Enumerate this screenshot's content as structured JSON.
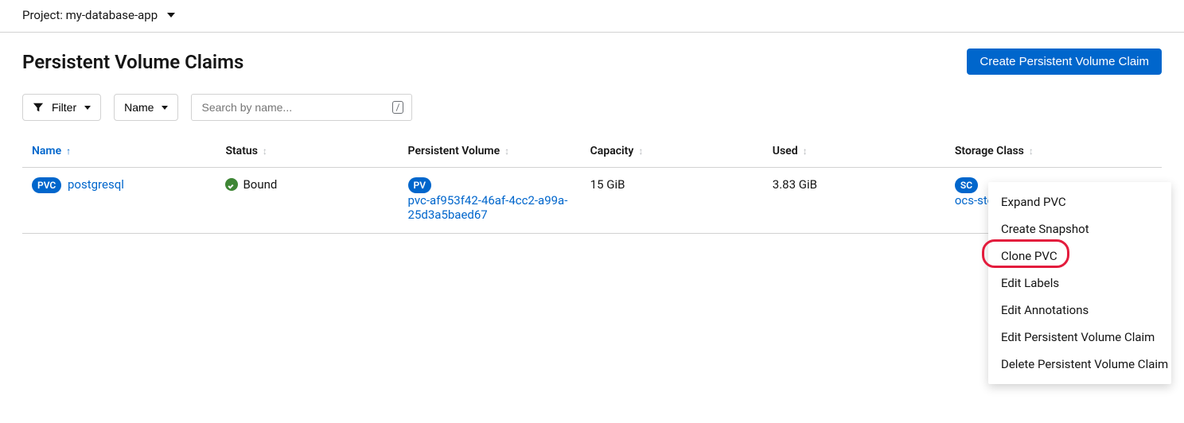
{
  "project": {
    "label_prefix": "Project: ",
    "name": "my-database-app"
  },
  "page": {
    "title": "Persistent Volume Claims",
    "create_button": "Create Persistent Volume Claim"
  },
  "toolbar": {
    "filter_label": "Filter",
    "name_label": "Name",
    "search_placeholder": "Search by name...",
    "search_key": "/"
  },
  "columns": {
    "name": "Name",
    "status": "Status",
    "pv": "Persistent Volume",
    "capacity": "Capacity",
    "used": "Used",
    "sc": "Storage Class"
  },
  "badges": {
    "pvc": "PVC",
    "pv": "PV",
    "sc": "SC"
  },
  "rows": [
    {
      "name": "postgresql",
      "status": "Bound",
      "pv": "pvc-af953f42-46af-4cc2-a99a-25d3a5baed67",
      "capacity": "15 GiB",
      "used": "3.83 GiB",
      "sc": "ocs-storagecluster-ceph-r"
    }
  ],
  "kebab_menu": {
    "items": [
      "Expand PVC",
      "Create Snapshot",
      "Clone PVC",
      "Edit Labels",
      "Edit Annotations",
      "Edit Persistent Volume Claim",
      "Delete Persistent Volume Claim"
    ],
    "highlighted_index": 2
  }
}
